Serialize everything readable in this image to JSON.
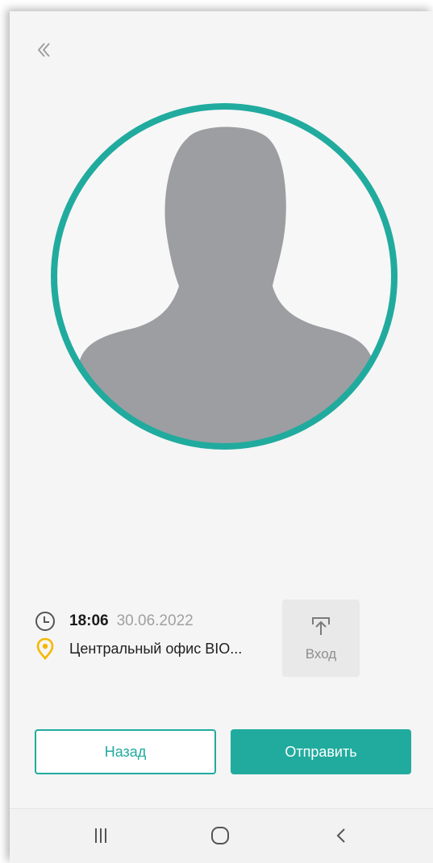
{
  "colors": {
    "accent": "#21ab9e",
    "location_pin": "#f5b800",
    "silhouette": "#9d9ea2",
    "screen_background": "#f5f5f5"
  },
  "header": {
    "back_icon": "double-chevron-left-icon"
  },
  "photo": {
    "placeholder_icon": "person-silhouette-icon"
  },
  "info": {
    "time": "18:06",
    "date": "30.06.2022",
    "location": "Центральный офис BIO..."
  },
  "entry": {
    "icon": "upload-arrow-icon",
    "label": "Вход"
  },
  "buttons": {
    "back_label": "Назад",
    "send_label": "Отправить"
  },
  "navbar": {
    "recents_icon": "recent-apps-icon",
    "home_icon": "home-icon",
    "back_icon": "back-chevron-icon"
  }
}
